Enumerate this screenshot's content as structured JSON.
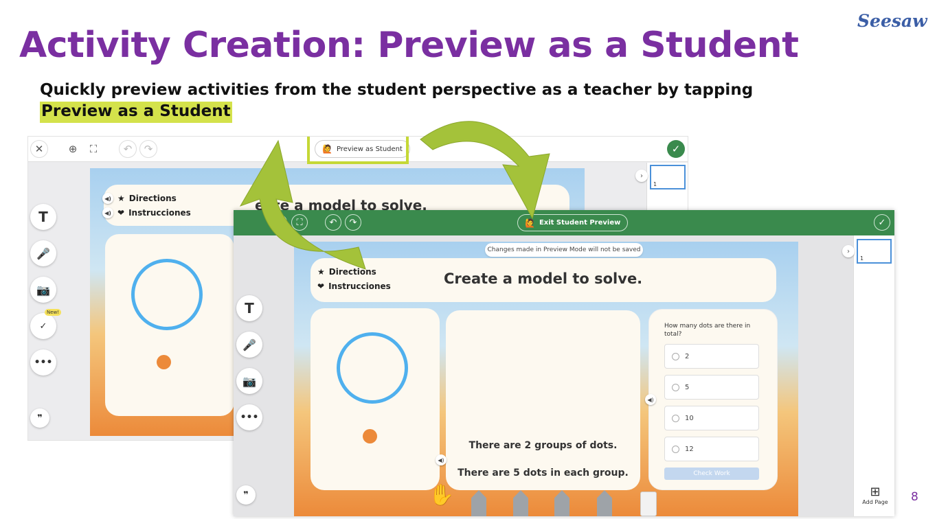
{
  "slide": {
    "title": "Activity Creation: Preview as a Student",
    "logo": "Seesaw",
    "subtitle": "Quickly preview activities from the student perspective as a teacher by tapping",
    "highlight": "Preview as a Student",
    "page_number": "8"
  },
  "editor": {
    "preview_button_label": "Preview as Student",
    "directions": [
      {
        "icon": "★",
        "label": "Directions"
      },
      {
        "icon": "❤",
        "label": "Instrucciones"
      }
    ],
    "instruction_partial": "eate a model to solve.",
    "new_badge": "New!",
    "thumb_page": "1"
  },
  "preview": {
    "exit_button_label": "Exit Student Preview",
    "notice": "Changes made in Preview Mode will not be saved",
    "directions": [
      {
        "icon": "★",
        "label": "Directions"
      },
      {
        "icon": "❤",
        "label": "Instrucciones"
      }
    ],
    "instruction": "Create a model to solve.",
    "text_line1": "There are 2 groups of dots.",
    "text_line2": "There are 5 dots in each group.",
    "question": "How many dots are there in total?",
    "options": [
      "2",
      "5",
      "10",
      "12"
    ],
    "check_work": "Check Work",
    "add_page": "Add Page",
    "thumb_page": "1"
  },
  "colors": {
    "title_purple": "#7a2fa1",
    "highlight_yellow": "#d4e24b",
    "toolbar_green": "#3a8a4d",
    "arrow_green": "#a4c23a"
  }
}
